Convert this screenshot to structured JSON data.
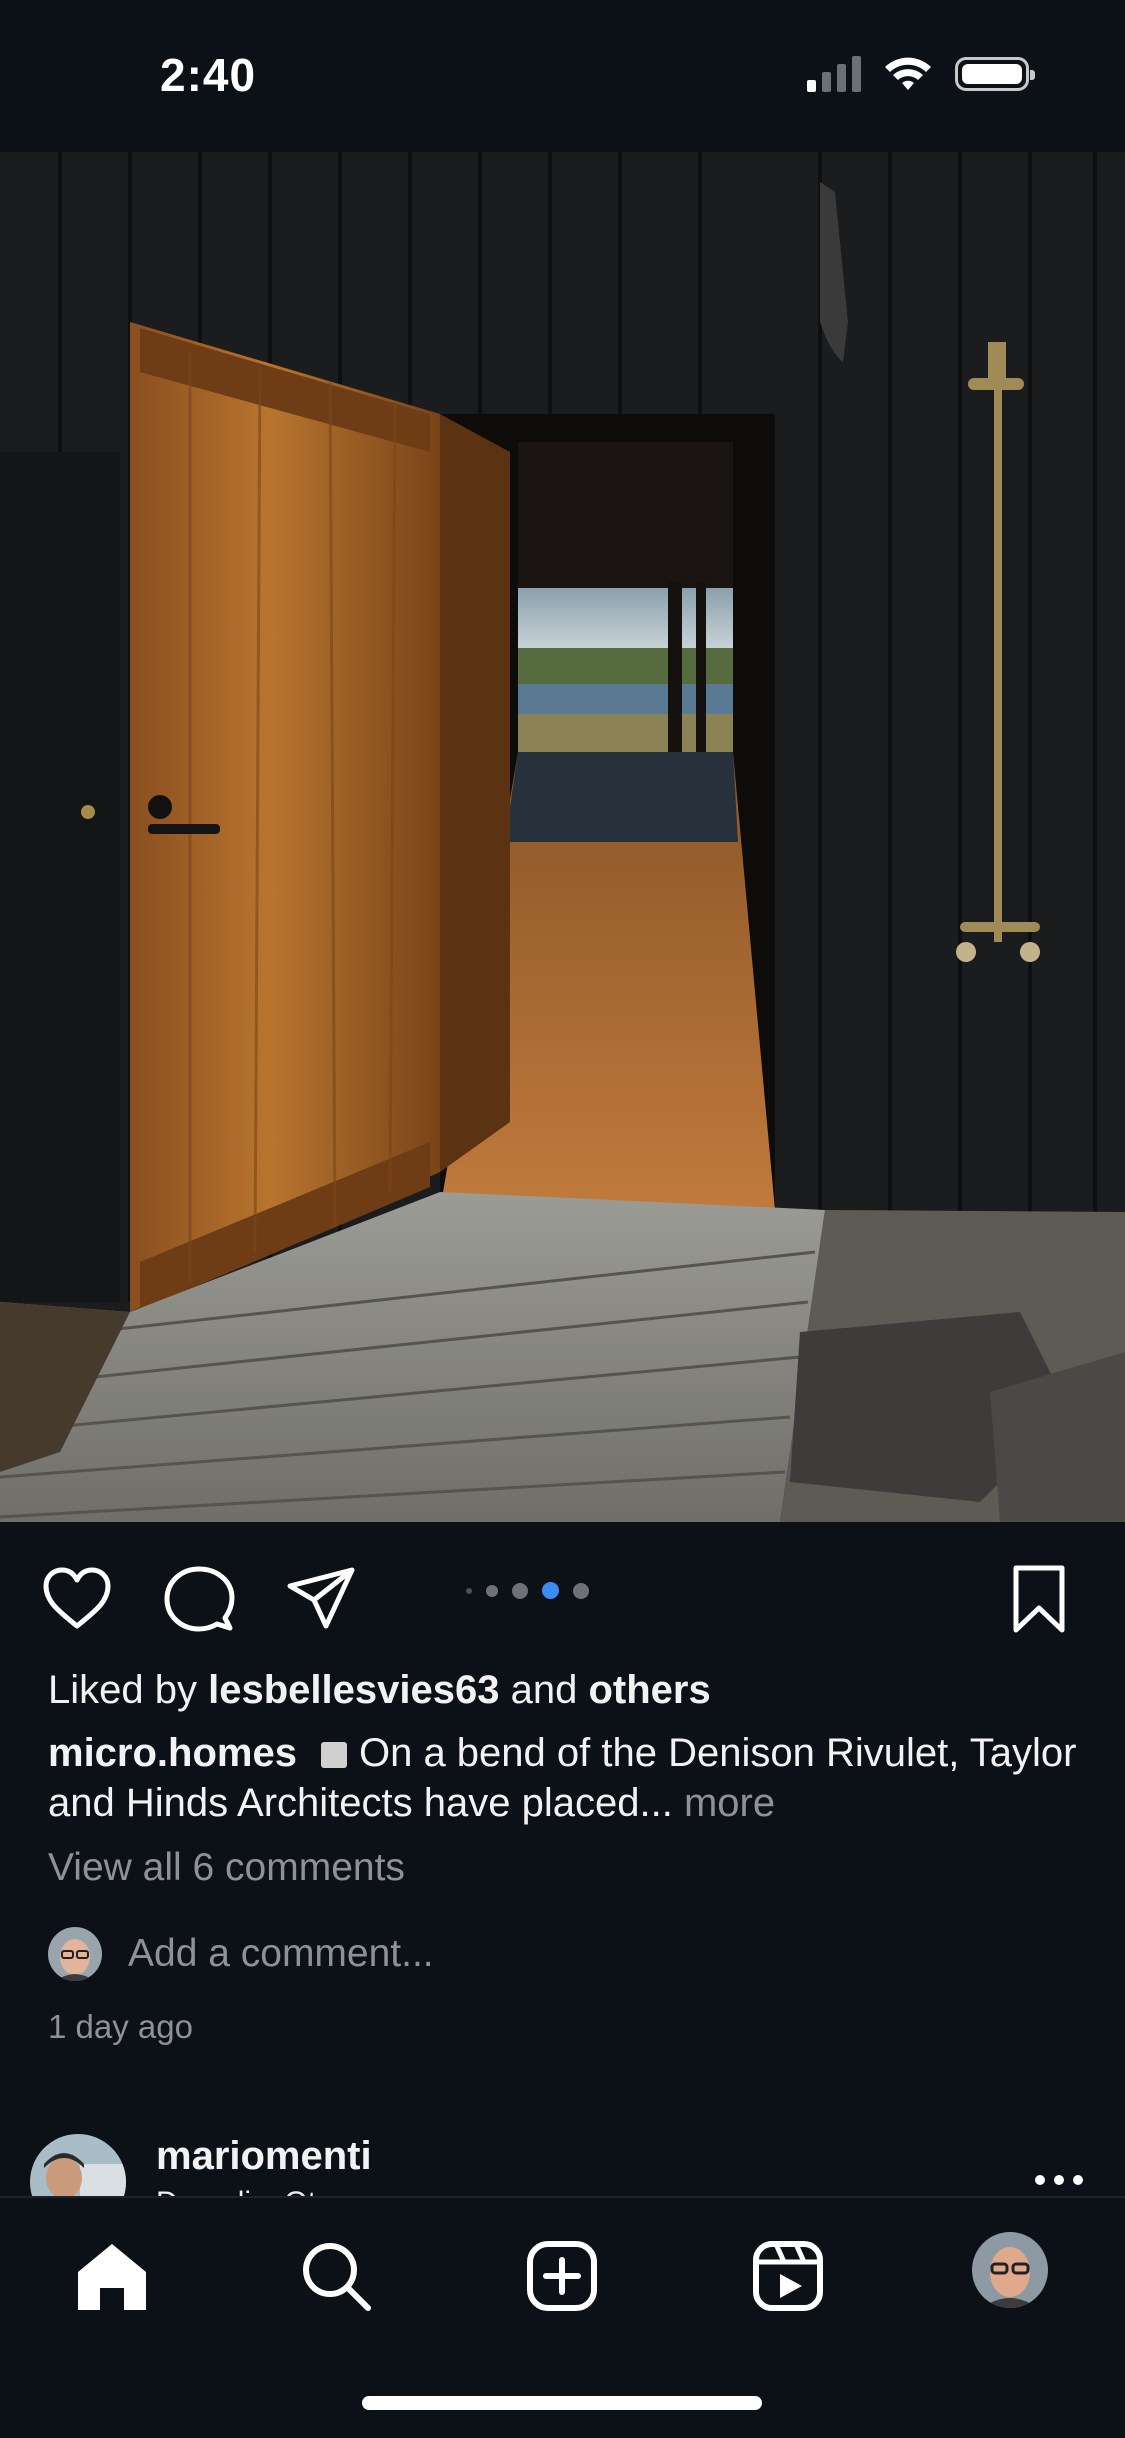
{
  "status_bar": {
    "time": "2:40"
  },
  "post": {
    "image_alt": "Black timber house with open wooden door and outdoor shower",
    "carousel": {
      "count": 5,
      "active_index": 3
    },
    "liked_by_prefix": "Liked by ",
    "liked_by_user": "lesbellesvies63",
    "liked_by_middle": " and ",
    "liked_by_others": "others",
    "caption_user": "micro.homes",
    "caption_text": "On a bend of the Denison Rivulet, Taylor and Hinds Architects have placed...",
    "caption_more": "more",
    "view_comments": "View all 6 comments",
    "add_comment_placeholder": "Add a comment...",
    "timestamp": "1 day ago"
  },
  "next_post": {
    "username": "mariomenti",
    "subtitle": "Dunedin, Otago"
  },
  "colors": {
    "background": "#0c1017",
    "accent_dot": "#3b8cf5",
    "muted_text": "#8e9197"
  },
  "icons": {
    "actions": [
      "heart-icon",
      "comment-icon",
      "share-icon",
      "bookmark-icon"
    ],
    "tabs": [
      "home-icon",
      "search-icon",
      "create-icon",
      "reels-icon",
      "profile-avatar"
    ]
  }
}
